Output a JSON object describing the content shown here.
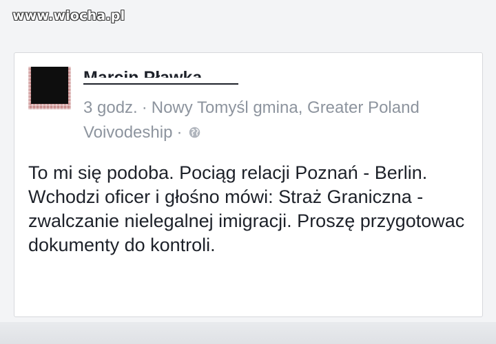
{
  "watermark": "www.wiocha.pl",
  "post": {
    "author": "Marcin Pławka",
    "time": "3 godz.",
    "separator": "·",
    "location": "Nowy Tomyśl gmina, Greater Poland Voivodeship",
    "privacy_icon": "globe-icon",
    "text": "To mi się podoba. Pociąg relacji Poznań - Berlin. Wchodzi oficer i głośno mówi: Straż Graniczna - zwalczanie nielegalnej imigracji. Proszę przygotowac dokumenty do kontroli."
  },
  "colors": {
    "background": "#f3f4f6",
    "card": "#ffffff",
    "text": "#1d2129",
    "meta": "#8d949e"
  }
}
